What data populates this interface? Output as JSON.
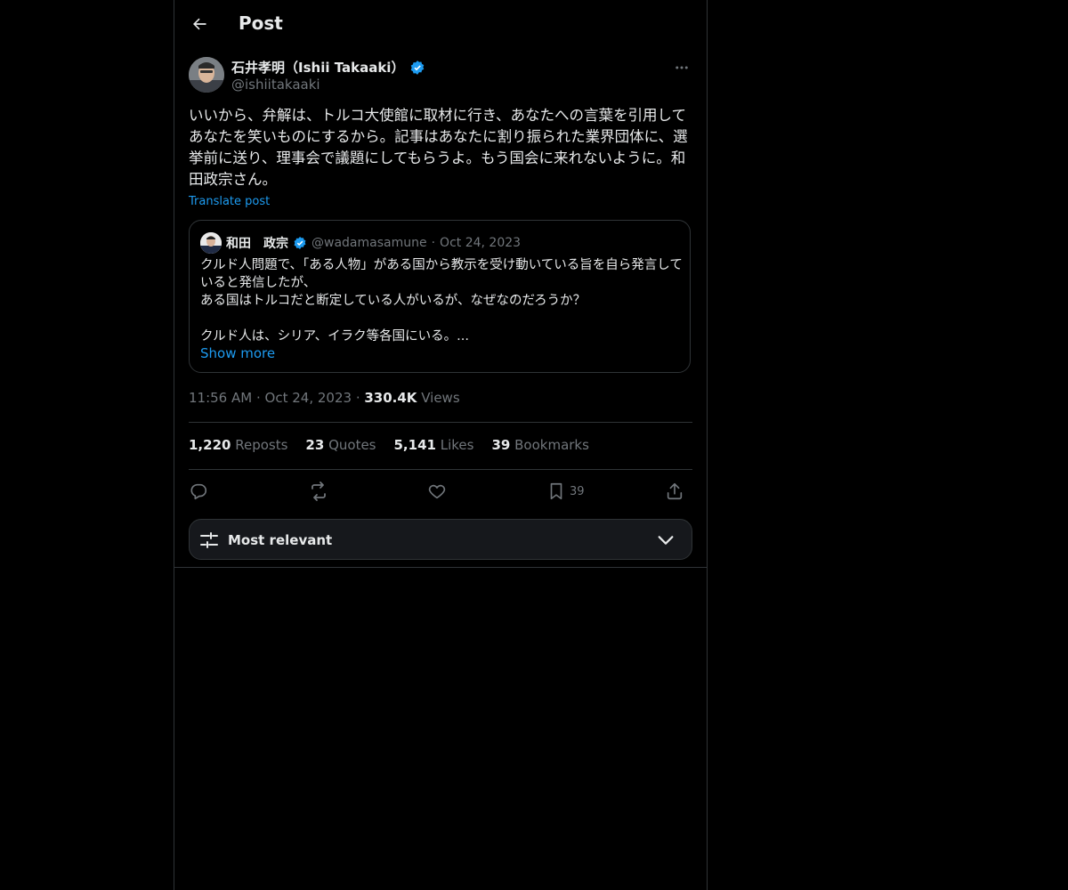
{
  "header": {
    "title": "Post"
  },
  "post": {
    "author_name": "石井孝明（Ishii Takaaki）",
    "author_handle": "@ishiitakaaki",
    "text": "いいから、弁解は、トルコ大使館に取材に行き、あなたへの言葉を引用してあなたを笑いものにするから。記事はあなたに割り振られた業界団体に、選挙前に送り、理事会で議題にしてもらうよ。もう国会に来れないように。和田政宗さん。",
    "translate_label": "Translate post",
    "time": "11:56 AM",
    "date": "Oct 24, 2023",
    "views_count": "330.4K",
    "views_label": "Views"
  },
  "quote": {
    "name": "和田　政宗",
    "handle": "@wadamasamune",
    "date": "Oct 24, 2023",
    "text": "クルド人問題で、「ある人物」がある国から教示を受け動いている旨を自ら発言していると発信したが、\nある国はトルコだと断定している人がいるが、なぜなのだろうか？\n\nクルド人は、シリア、イラク等各国にいる。...",
    "show_more": "Show more"
  },
  "stats": {
    "reposts_count": "1,220",
    "reposts_label": "Reposts",
    "quotes_count": "23",
    "quotes_label": "Quotes",
    "likes_count": "5,141",
    "likes_label": "Likes",
    "bookmarks_count": "39",
    "bookmarks_label": "Bookmarks"
  },
  "actions": {
    "bookmark_count": "39"
  },
  "sort": {
    "label": "Most relevant"
  },
  "colors": {
    "accent": "#1d9bf0",
    "background": "#000000",
    "secondary_text": "#71767b",
    "border": "#2f3336"
  },
  "icons": [
    "back-arrow-icon",
    "verified-badge-icon",
    "more-dots-icon",
    "reply-icon",
    "repost-icon",
    "like-icon",
    "bookmark-icon",
    "share-icon",
    "sort-settings-icon",
    "chevron-down-icon"
  ]
}
